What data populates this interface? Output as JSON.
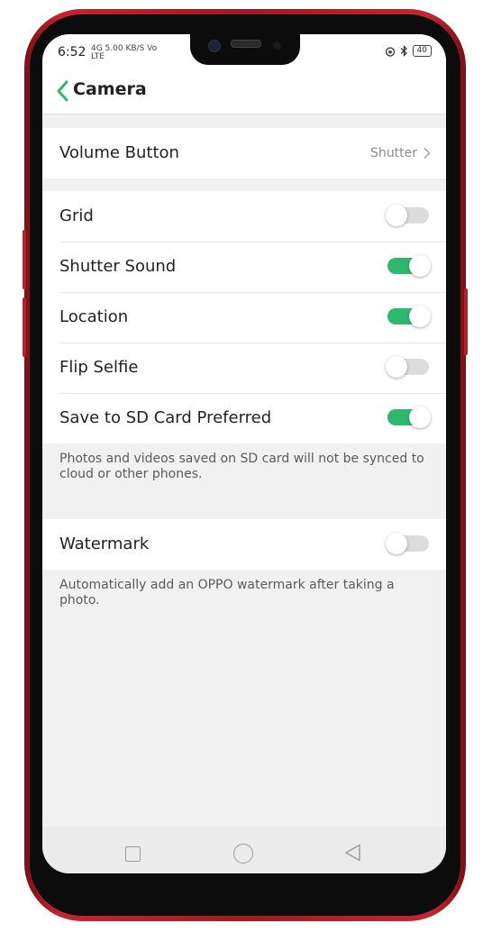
{
  "status": {
    "time": "6:52",
    "network": "4G 5.00 KB/S Vo LTE",
    "battery": "40",
    "icons": [
      "alarm-icon",
      "bluetooth-icon",
      "battery-icon"
    ]
  },
  "header": {
    "title": "Camera"
  },
  "settings": {
    "volume_button": {
      "label": "Volume Button",
      "value": "Shutter"
    },
    "grid": {
      "label": "Grid",
      "on": false
    },
    "shutter_sound": {
      "label": "Shutter Sound",
      "on": true
    },
    "location": {
      "label": "Location",
      "on": true
    },
    "flip_selfie": {
      "label": "Flip Selfie",
      "on": false
    },
    "save_sd": {
      "label": "Save to SD Card Preferred",
      "on": true
    },
    "sd_note": "Photos and videos saved on SD card will not be synced to cloud or other phones.",
    "watermark": {
      "label": "Watermark",
      "on": false
    },
    "watermark_note": "Automatically add an OPPO watermark after taking a photo."
  },
  "colors": {
    "accent": "#2fb76e",
    "background": "#f1f1f1"
  }
}
